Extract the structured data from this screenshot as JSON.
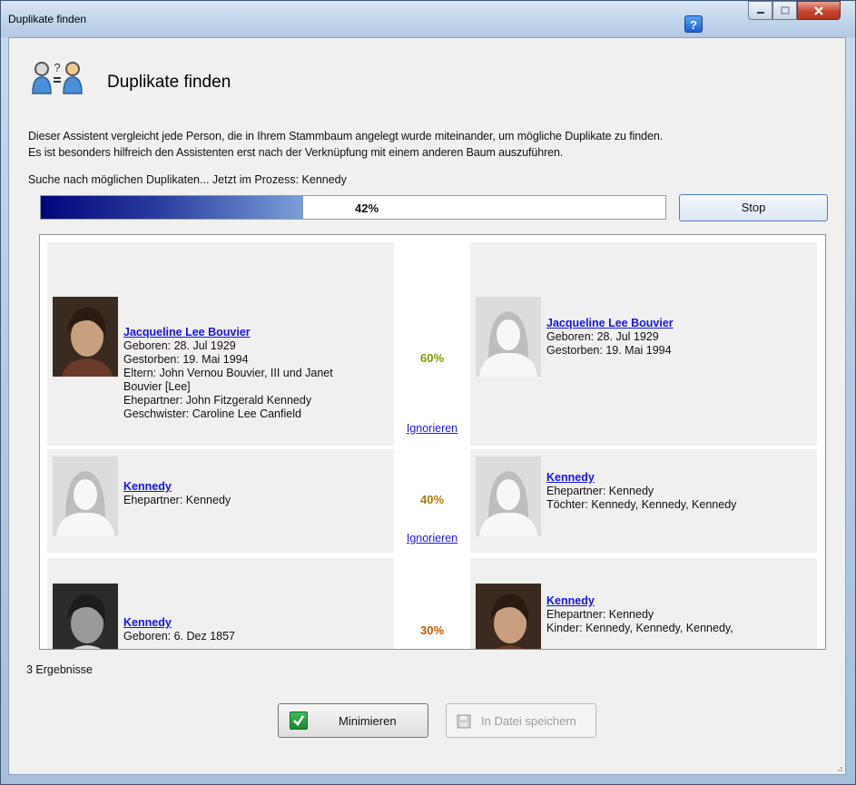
{
  "window": {
    "title": "Duplikate finden",
    "help_label": "?"
  },
  "header": {
    "title": "Duplikate finden"
  },
  "description": {
    "line1": "Dieser Assistent vergleicht jede Person, die in Ihrem Stammbaum angelegt wurde miteinander, um mögliche Duplikate zu finden.",
    "line2": "Es ist besonders hilfreich den Assistenten erst nach der Verknüpfung mit einem anderen Baum auszuführen."
  },
  "status_text": "Suche nach möglichen Duplikaten... Jetzt im Prozess: Kennedy",
  "progress": {
    "value": 0.42,
    "label": "42%"
  },
  "stop_label": "Stop",
  "results": [
    {
      "left": {
        "name": "Jacqueline Lee Bouvier",
        "details": [
          "Geboren: 28. Jul 1929",
          "Gestorben: 19. Mai 1994",
          "Eltern: John Vernou Bouvier, III und Janet",
          "Bouvier [Lee]",
          "Ehepartner: John Fitzgerald Kennedy",
          "Geschwister: Caroline Lee Canfield"
        ],
        "photo": "portrait-photo"
      },
      "match": {
        "percent": "60%",
        "color": "#7a9a00",
        "ignore_label": "Ignorieren"
      },
      "right": {
        "name": "Jacqueline Lee Bouvier",
        "details": [
          "Geboren: 28. Jul 1929",
          "Gestorben: 19. Mai 1994"
        ],
        "photo": "female-silhouette"
      }
    },
    {
      "left": {
        "name": "Kennedy",
        "details": [
          "Ehepartner: Kennedy"
        ],
        "photo": "female-silhouette"
      },
      "match": {
        "percent": "40%",
        "color": "#b07a00",
        "ignore_label": "Ignorieren"
      },
      "right": {
        "name": "Kennedy",
        "details": [
          "Ehepartner: Kennedy",
          "Töchter: Kennedy, Kennedy, Kennedy"
        ],
        "photo": "female-silhouette"
      }
    },
    {
      "left": {
        "name": "Kennedy",
        "details": [
          "Geboren: 6. Dez 1857"
        ],
        "photo": "portrait-photo"
      },
      "match": {
        "percent": "30%",
        "color": "#c05a00",
        "ignore_label": ""
      },
      "right": {
        "name": "Kennedy",
        "details": [
          "Ehepartner: Kennedy",
          "Kinder: Kennedy, Kennedy, Kennedy,"
        ],
        "photo": "portrait-photo"
      }
    }
  ],
  "result_count": "3 Ergebnisse",
  "buttons": {
    "minimize": "Minimieren",
    "save": "In Datei speichern"
  },
  "colors": {
    "link": "#1515e6",
    "progress_fill": "#00057c"
  }
}
